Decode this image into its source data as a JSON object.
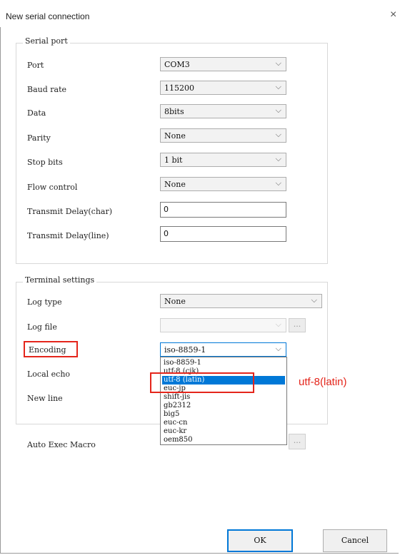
{
  "window": {
    "title": "New serial connection",
    "close_glyph": "×"
  },
  "serial_port": {
    "label": "Serial port",
    "port": {
      "label": "Port",
      "value": "COM3"
    },
    "baud_rate": {
      "label": "Baud rate",
      "value": "115200"
    },
    "data": {
      "label": "Data",
      "value": "8bits"
    },
    "parity": {
      "label": "Parity",
      "value": "None"
    },
    "stop_bits": {
      "label": "Stop bits",
      "value": "1 bit"
    },
    "flow_control": {
      "label": "Flow control",
      "value": "None"
    },
    "transmit_delay_char": {
      "label": "Transmit Delay(char)",
      "value": "0"
    },
    "transmit_delay_line": {
      "label": "Transmit Delay(line)",
      "value": "0"
    }
  },
  "terminal_settings": {
    "label": "Terminal settings",
    "log_type": {
      "label": "Log type",
      "value": "None"
    },
    "log_file": {
      "label": "Log file",
      "value": "",
      "browse_label": "..."
    },
    "encoding": {
      "label": "Encoding",
      "value": "iso-8859-1",
      "options": [
        "iso-8859-1",
        "utf-8 (cjk)",
        "utf-8 (latin)",
        "euc-jp",
        "shift-jis",
        "gb2312",
        "big5",
        "euc-cn",
        "euc-kr",
        "oem850"
      ],
      "highlighted": "utf-8 (latin)"
    },
    "local_echo": {
      "label": "Local echo"
    },
    "new_line": {
      "label": "New line"
    }
  },
  "auto_exec_macro": {
    "label": "Auto Exec Macro",
    "browse_label": "..."
  },
  "annotation": {
    "text": "utf-8(latin)",
    "color": "#e4251b"
  },
  "buttons": {
    "ok": "OK",
    "cancel": "Cancel"
  },
  "colors": {
    "selection": "#0078d7",
    "annotation_red": "#e4251b"
  },
  "icons": {
    "combo_arrow": "chevron-down-icon",
    "close": "close-icon"
  }
}
